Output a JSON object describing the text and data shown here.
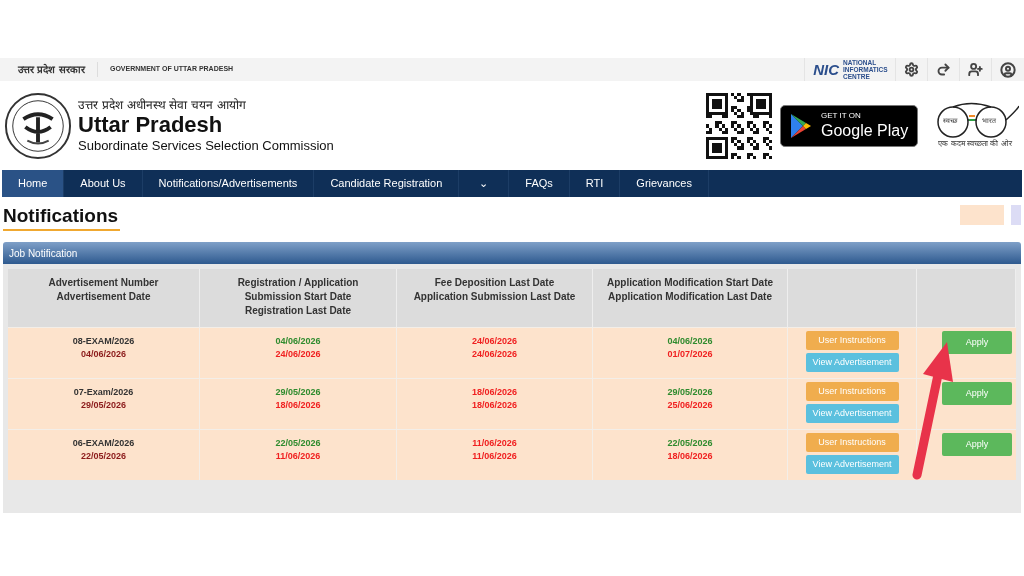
{
  "top_bar": {
    "hindi_label": "उत्तर प्रदेश सरकार",
    "label": "GOVERNMENT OF UTTAR PRADESH",
    "nic": {
      "mark": "NIC",
      "name": "NATIONAL INFORMATICS CENTRE"
    }
  },
  "header": {
    "hindi_title": "उत्तर प्रदेश अधीनस्थ सेवा चयन आयोग",
    "title": "Uttar Pradesh",
    "subtitle": "Subordinate Services Selection Commission",
    "store_badge": {
      "small": "GET IT ON",
      "big": "Google Play"
    },
    "swachh": {
      "left": "स्वच्छ",
      "right": "भारत",
      "tagline": "एक कदम स्वच्छता की ओर"
    }
  },
  "nav": [
    {
      "label": "Home",
      "selected": true,
      "kind": "link"
    },
    {
      "label": "About Us",
      "selected": false,
      "kind": "link"
    },
    {
      "label": "Notifications/Advertisements",
      "selected": false,
      "kind": "link"
    },
    {
      "label": "Candidate Registration",
      "selected": false,
      "kind": "link"
    },
    {
      "label": "⌄",
      "selected": false,
      "kind": "toggle"
    },
    {
      "label": "FAQs",
      "selected": false,
      "kind": "link"
    },
    {
      "label": "RTI",
      "selected": false,
      "kind": "link"
    },
    {
      "label": "Grievances",
      "selected": false,
      "kind": "link"
    }
  ],
  "page_title": "Notifications",
  "legend": [
    {
      "color": "#fde3cc"
    },
    {
      "color": "#dcdcf5"
    }
  ],
  "panel": {
    "title": "Job Notification",
    "columns": [
      "Advertisement Number\nAdvertisement Date",
      "Registration / Application\nSubmission  Start Date\nRegistration Last Date",
      "Fee Deposition Last Date\nApplication Submission Last Date",
      "Application Modification Start Date\nApplication Modification Last Date"
    ],
    "rows": [
      {
        "cells": [
          [
            {
              "text": "08-EXAM/2026",
              "color": "#333333"
            },
            {
              "text": "04/06/2026",
              "color": "#8b1a1a"
            }
          ],
          [
            {
              "text": "04/06/2026",
              "color": "#2e8b2e"
            },
            {
              "text": "24/06/2026",
              "color": "#f02020"
            }
          ],
          [
            {
              "text": "24/06/2026",
              "color": "#f02020"
            },
            {
              "text": "24/06/2026",
              "color": "#f02020"
            }
          ],
          [
            {
              "text": "04/06/2026",
              "color": "#2e8b2e"
            },
            {
              "text": "01/07/2026",
              "color": "#f02020"
            }
          ]
        ],
        "instructions": "User Instructions",
        "advertisement": "View Advertisement",
        "apply": "Apply"
      },
      {
        "cells": [
          [
            {
              "text": "07-Exam/2026",
              "color": "#333333"
            },
            {
              "text": "29/05/2026",
              "color": "#8b1a1a"
            }
          ],
          [
            {
              "text": "29/05/2026",
              "color": "#2e8b2e"
            },
            {
              "text": "18/06/2026",
              "color": "#f02020"
            }
          ],
          [
            {
              "text": "18/06/2026",
              "color": "#f02020"
            },
            {
              "text": "18/06/2026",
              "color": "#f02020"
            }
          ],
          [
            {
              "text": "29/05/2026",
              "color": "#2e8b2e"
            },
            {
              "text": "25/06/2026",
              "color": "#f02020"
            }
          ]
        ],
        "instructions": "User Instructions",
        "advertisement": "View Advertisement",
        "apply": "Apply"
      },
      {
        "cells": [
          [
            {
              "text": "06-EXAM/2026",
              "color": "#333333"
            },
            {
              "text": "22/05/2026",
              "color": "#8b1a1a"
            }
          ],
          [
            {
              "text": "22/05/2026",
              "color": "#2e8b2e"
            },
            {
              "text": "11/06/2026",
              "color": "#f02020"
            }
          ],
          [
            {
              "text": "11/06/2026",
              "color": "#f02020"
            },
            {
              "text": "11/06/2026",
              "color": "#f02020"
            }
          ],
          [
            {
              "text": "22/05/2026",
              "color": "#2e8b2e"
            },
            {
              "text": "18/06/2026",
              "color": "#f02020"
            }
          ]
        ],
        "instructions": "User Instructions",
        "advertisement": "View Advertisement",
        "apply": "Apply"
      }
    ]
  }
}
